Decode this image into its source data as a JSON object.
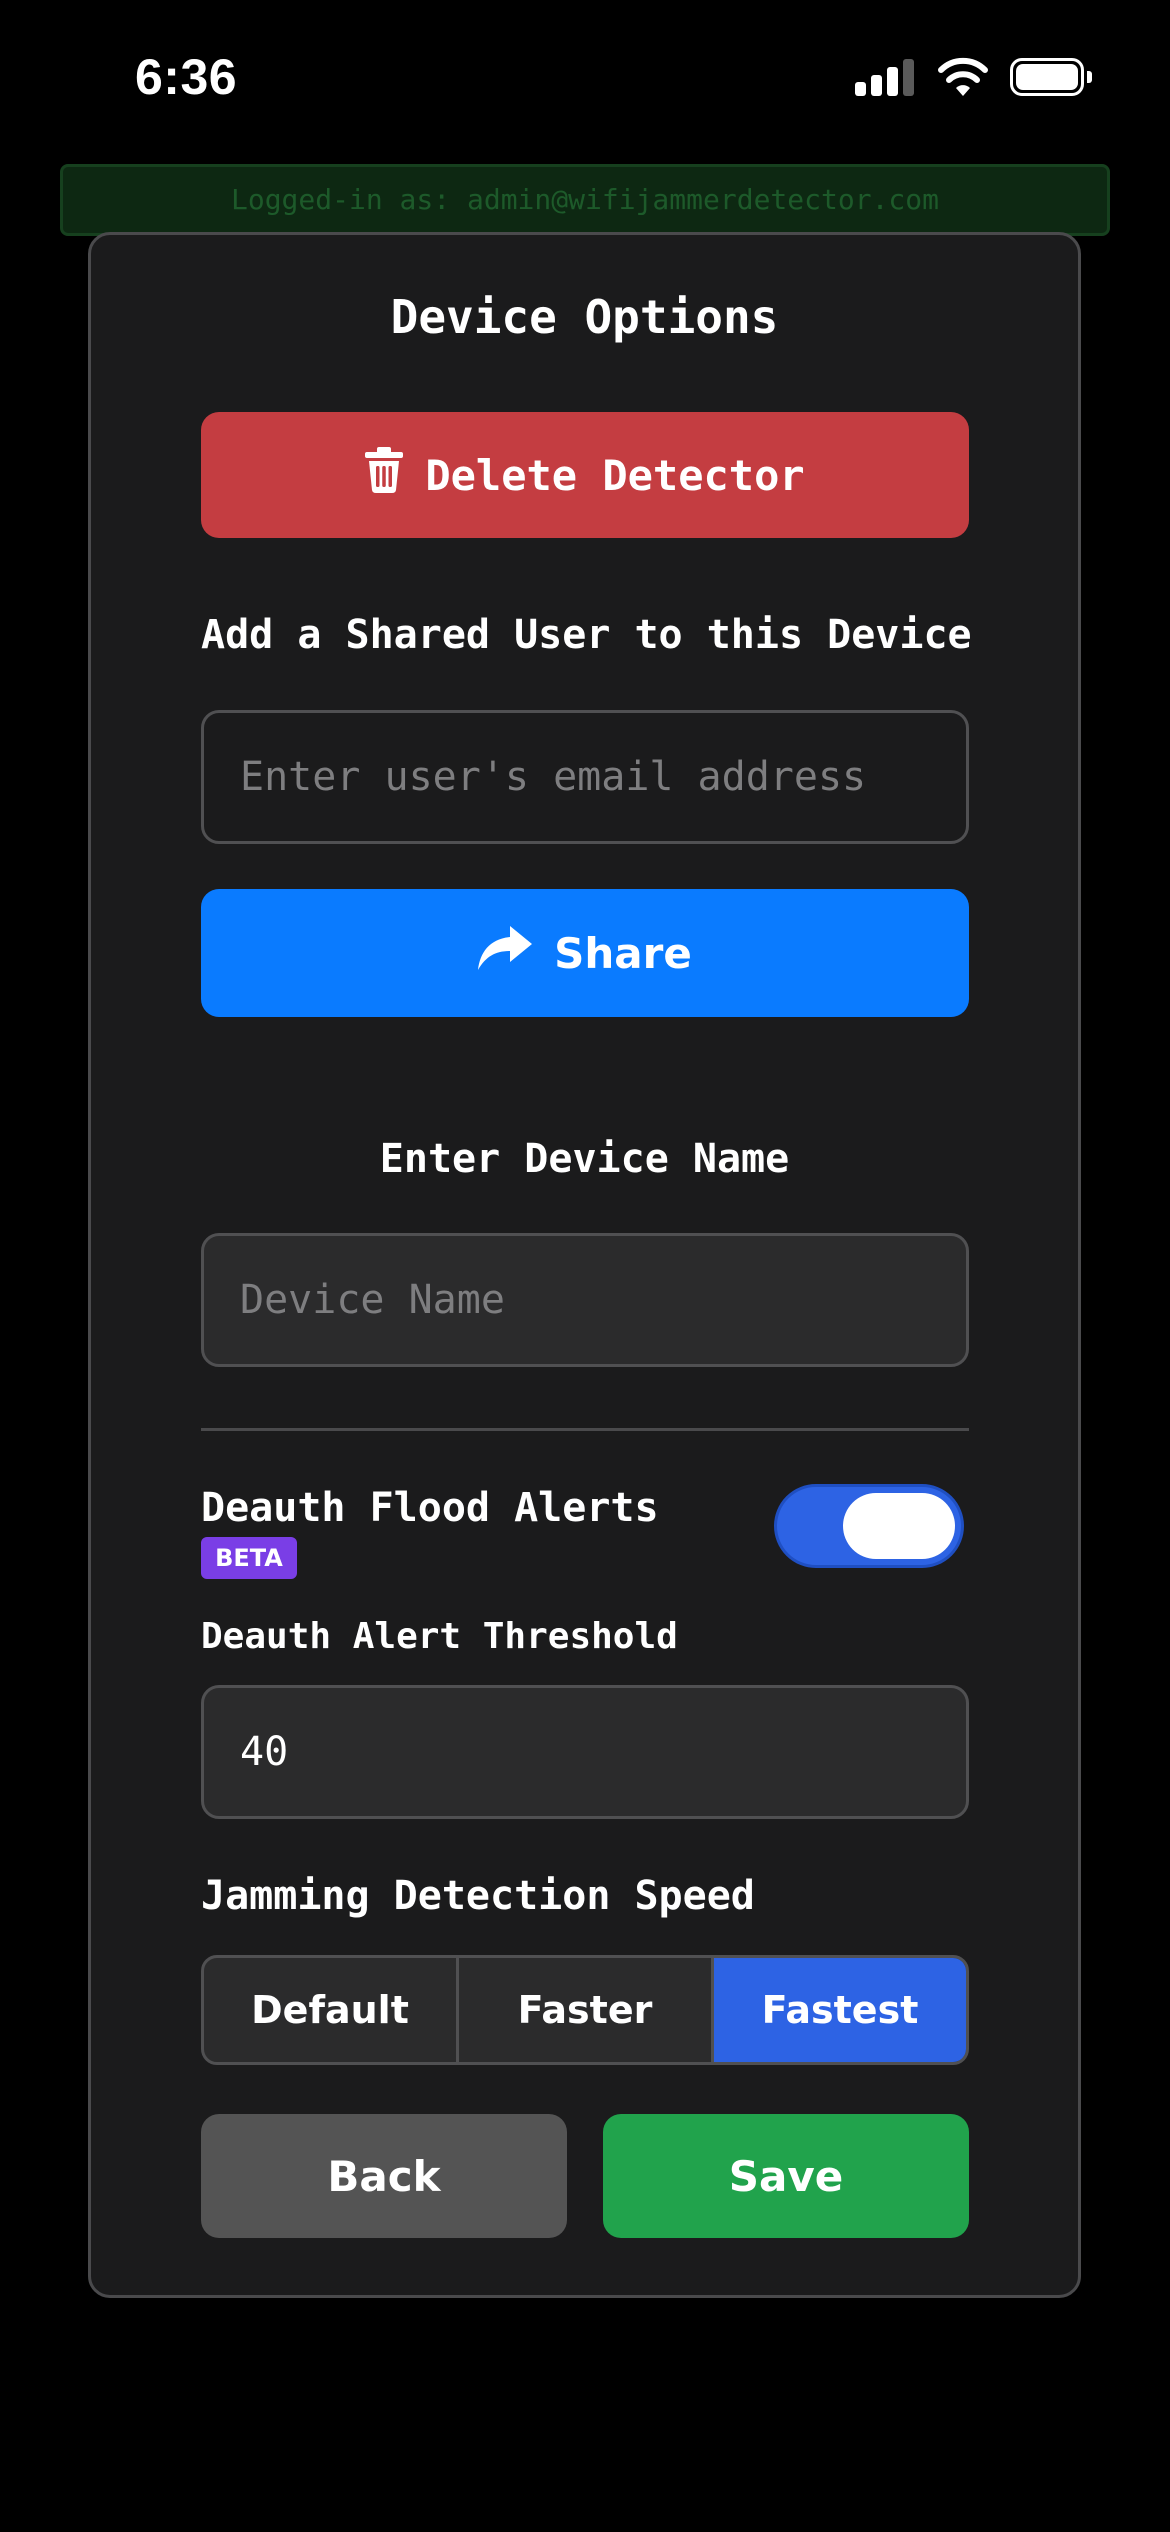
{
  "status_bar": {
    "time": "6:36"
  },
  "banner": {
    "text": "Logged-in as: admin@wifijammerdetector.com"
  },
  "modal": {
    "title": "Device Options",
    "delete_button": {
      "label": "Delete Detector",
      "icon": "trash-icon",
      "color": "#c43d41"
    },
    "shared_user": {
      "label": "Add a Shared User to this Device",
      "email_value": "",
      "email_placeholder": "Enter user's email address",
      "share_button_label": "Share",
      "share_icon": "share-arrow-icon",
      "share_color": "#0a7bff"
    },
    "device_name": {
      "label": "Enter Device Name",
      "value": "",
      "placeholder": "Device Name"
    },
    "deauth": {
      "label": "Deauth Flood Alerts",
      "badge": "BETA",
      "badge_color": "#7a3ee6",
      "toggle_on": true,
      "threshold_label": "Deauth Alert Threshold",
      "threshold_value": "40"
    },
    "jamming_speed": {
      "label": "Jamming Detection Speed",
      "options": [
        "Default",
        "Faster",
        "Fastest"
      ],
      "selected": "Fastest",
      "selected_color": "#2d63e4"
    },
    "actions": {
      "back_label": "Back",
      "save_label": "Save",
      "save_color": "#21a34c"
    }
  }
}
